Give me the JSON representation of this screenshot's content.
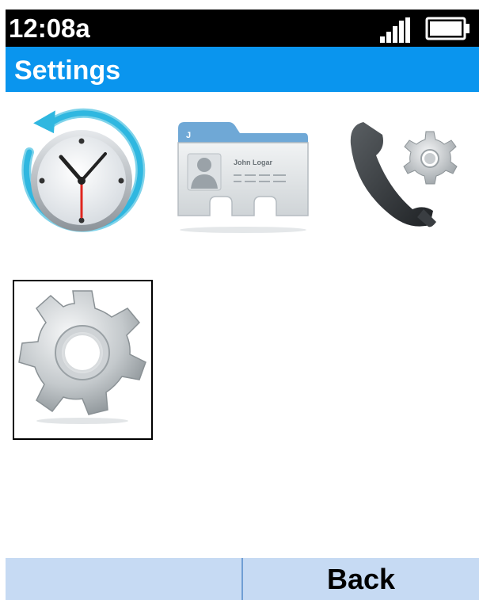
{
  "status_bar": {
    "time": "12:08a",
    "signal_icon": "signal-bars-icon",
    "battery_icon": "battery-icon"
  },
  "header": {
    "title": "Settings"
  },
  "grid": {
    "items": [
      {
        "icon": "clock-history-icon"
      },
      {
        "icon": "contact-card-icon",
        "card_name": "John Logar"
      },
      {
        "icon": "phone-settings-icon"
      },
      {
        "icon": "gear-icon",
        "selected": true
      }
    ]
  },
  "softkeys": {
    "left_label": "",
    "right_label": "Back"
  },
  "colors": {
    "status_bar_bg": "#000000",
    "title_bar_bg": "#0a95ee",
    "softkey_bg": "#c6daf3",
    "softkey_divider": "#6f9ed4"
  }
}
